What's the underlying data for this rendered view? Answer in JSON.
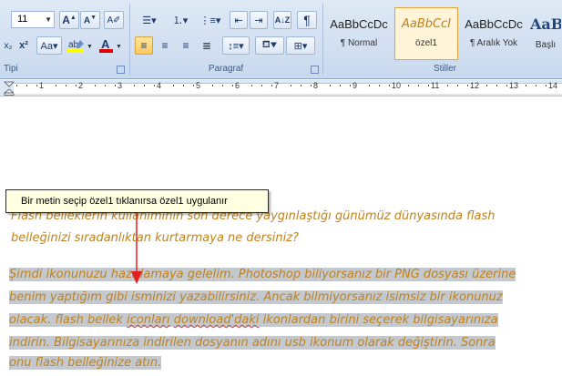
{
  "ribbon": {
    "font_group": {
      "caption": "Tipi",
      "font_size": "11"
    },
    "paragraph_group": {
      "caption": "Paragraf",
      "pilcrow": "¶"
    },
    "styles_group": {
      "caption": "Stiller",
      "tiles": [
        {
          "sample": "AaBbCcDc",
          "label": "¶ Normal"
        },
        {
          "sample": "AaBbCcI",
          "label": "özel1"
        },
        {
          "sample": "AaBbCcDc",
          "label": "¶ Aralık Yok"
        },
        {
          "sample": "AaBb",
          "label": "Başlı"
        }
      ]
    }
  },
  "ruler": {
    "numbers": [
      "1",
      "2",
      "3",
      "4",
      "5",
      "6",
      "7",
      "8",
      "9",
      "10",
      "11",
      "12",
      "13",
      "14"
    ]
  },
  "tooltip": {
    "text": "Bir metin seçip özel1 tıklanırsa özel1 uygulanır"
  },
  "document": {
    "para1": {
      "line1": "Flash belleklerin kullanımının son derece yaygınlaştığı günümüz dünyasında flash",
      "line2": "belleğinizi sıradanlıktan kurtarmaya ne dersiniz?"
    },
    "para2": {
      "line1": "Şimdi ikonunuzu hazırlamaya gelelim. Photoshop biliyorsanız bir PNG dosyası üzerine",
      "line2": "benim yaptığım gibi isminizi yazabilirsiniz. Ancak bilmiyorsanız isimsiz bir ikonunuz",
      "line3a": "olacak. flash bellek ",
      "line3b": "iconları",
      "line3c": " ",
      "line3d": "download'daki",
      "line3e": " ikonlardan birini seçerek bilgisayarınıza",
      "line4": "indirin. Bilgisayarınıza indirilen dosyanın adını usb ikonum olarak değiştirin. Sonra",
      "line5": "onu flash belleğinize atın."
    }
  },
  "colors": {
    "text_orange": "#c0821e",
    "selection": "#c3c9cf",
    "arrow": "#e02020"
  }
}
